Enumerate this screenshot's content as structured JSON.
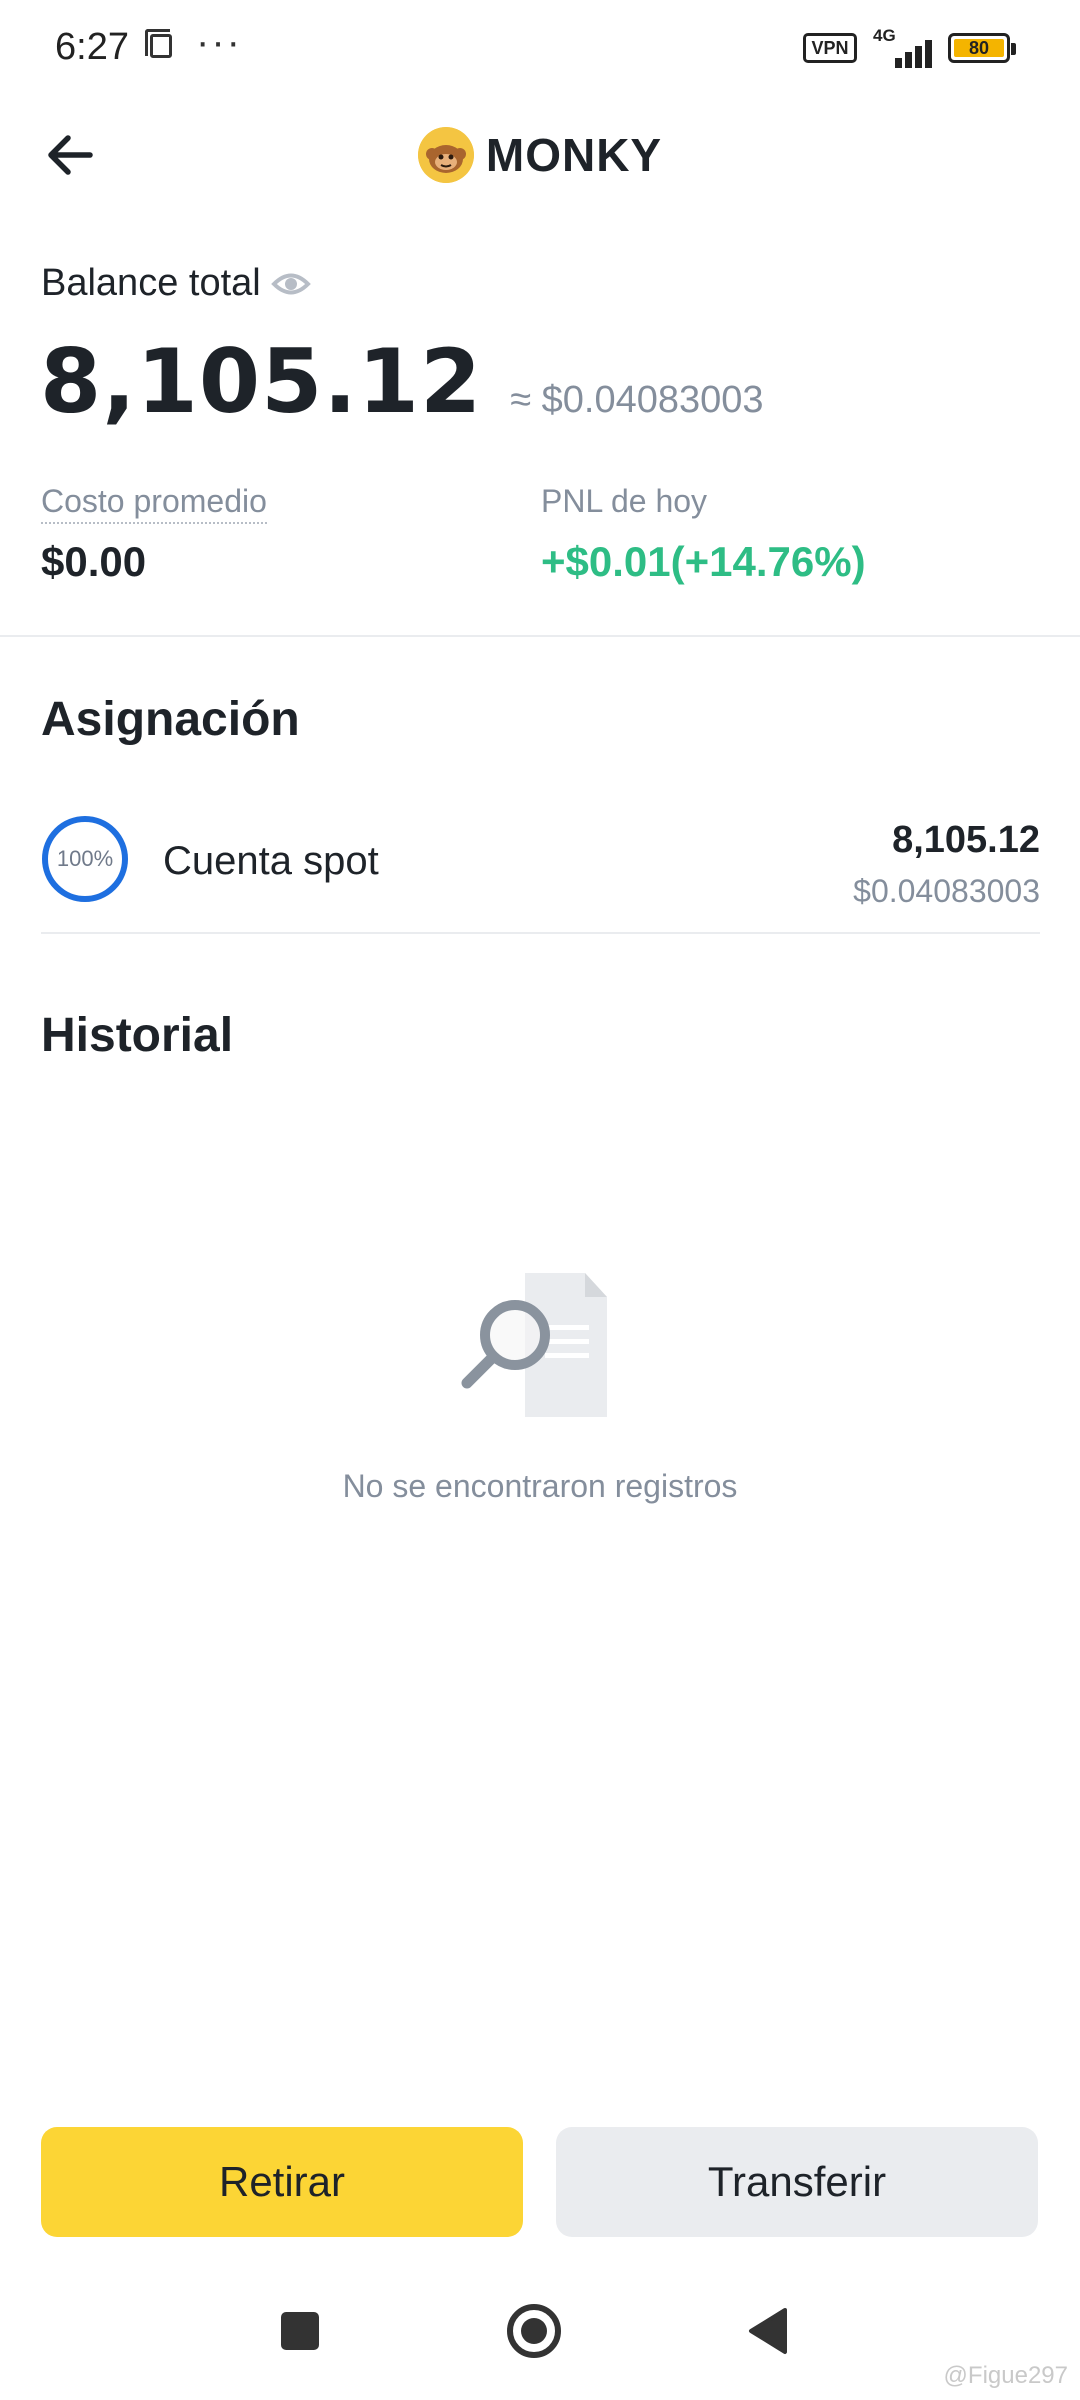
{
  "status_bar": {
    "time": "6:27",
    "dots": "···",
    "vpn": "VPN",
    "network": "4G",
    "battery": "80"
  },
  "header": {
    "coin_name": "MONKY",
    "back_icon": "arrow-left-icon",
    "coin_logo_icon": "monkey-coin-logo"
  },
  "balance": {
    "label": "Balance total",
    "amount": "8,105.12",
    "fiat": "≈ $0.04083003"
  },
  "stats": {
    "avg_cost_label": "Costo promedio",
    "avg_cost_value": "$0.00",
    "pnl_label": "PNL de hoy",
    "pnl_value": "+$0.01(+14.76%)"
  },
  "allocation": {
    "title": "Asignación",
    "items": [
      {
        "percent": "100%",
        "percent_value": 1.0,
        "name": "Cuenta spot",
        "amount": "8,105.12",
        "fiat": "$0.04083003"
      }
    ]
  },
  "history": {
    "title": "Historial",
    "empty_text": "No se encontraron registros"
  },
  "actions": {
    "withdraw": "Retirar",
    "transfer": "Transferir"
  },
  "watermark": "@Figue297",
  "colors": {
    "primary": "#fcd535",
    "positive": "#2ebd85",
    "ring": "#1e6fe0",
    "text": "#1e2329",
    "muted": "#848e9c"
  }
}
